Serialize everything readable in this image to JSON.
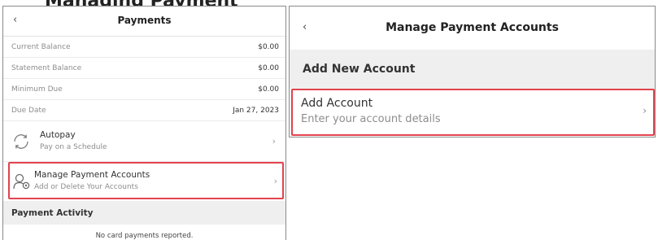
{
  "crop_title": "Managing Payment",
  "left": {
    "back_icon": "‹",
    "title": "Payments",
    "rows": [
      {
        "label": "Current Balance",
        "value": "$0.00"
      },
      {
        "label": "Statement Balance",
        "value": "$0.00"
      },
      {
        "label": "Minimum Due",
        "value": "$0.00"
      },
      {
        "label": "Due Date",
        "value": "Jan 27, 2023"
      }
    ],
    "autopay": {
      "title": "Autopay",
      "subtitle": "Pay on a Schedule",
      "icon": "refresh-icon",
      "chevron": "›"
    },
    "manage": {
      "title": "Manage Payment Accounts",
      "subtitle": "Add or Delete Your Accounts",
      "icon": "user-settings-icon",
      "chevron": "›"
    },
    "activity_heading": "Payment Activity",
    "empty_text": "No card payments reported."
  },
  "right": {
    "back_icon": "‹",
    "title": "Manage Payment Accounts",
    "section": "Add New Account",
    "add_account": {
      "title": "Add Account",
      "subtitle": "Enter your account details",
      "chevron": "›"
    }
  },
  "colors": {
    "highlight": "#e2434e",
    "section_bg": "#efefef"
  }
}
